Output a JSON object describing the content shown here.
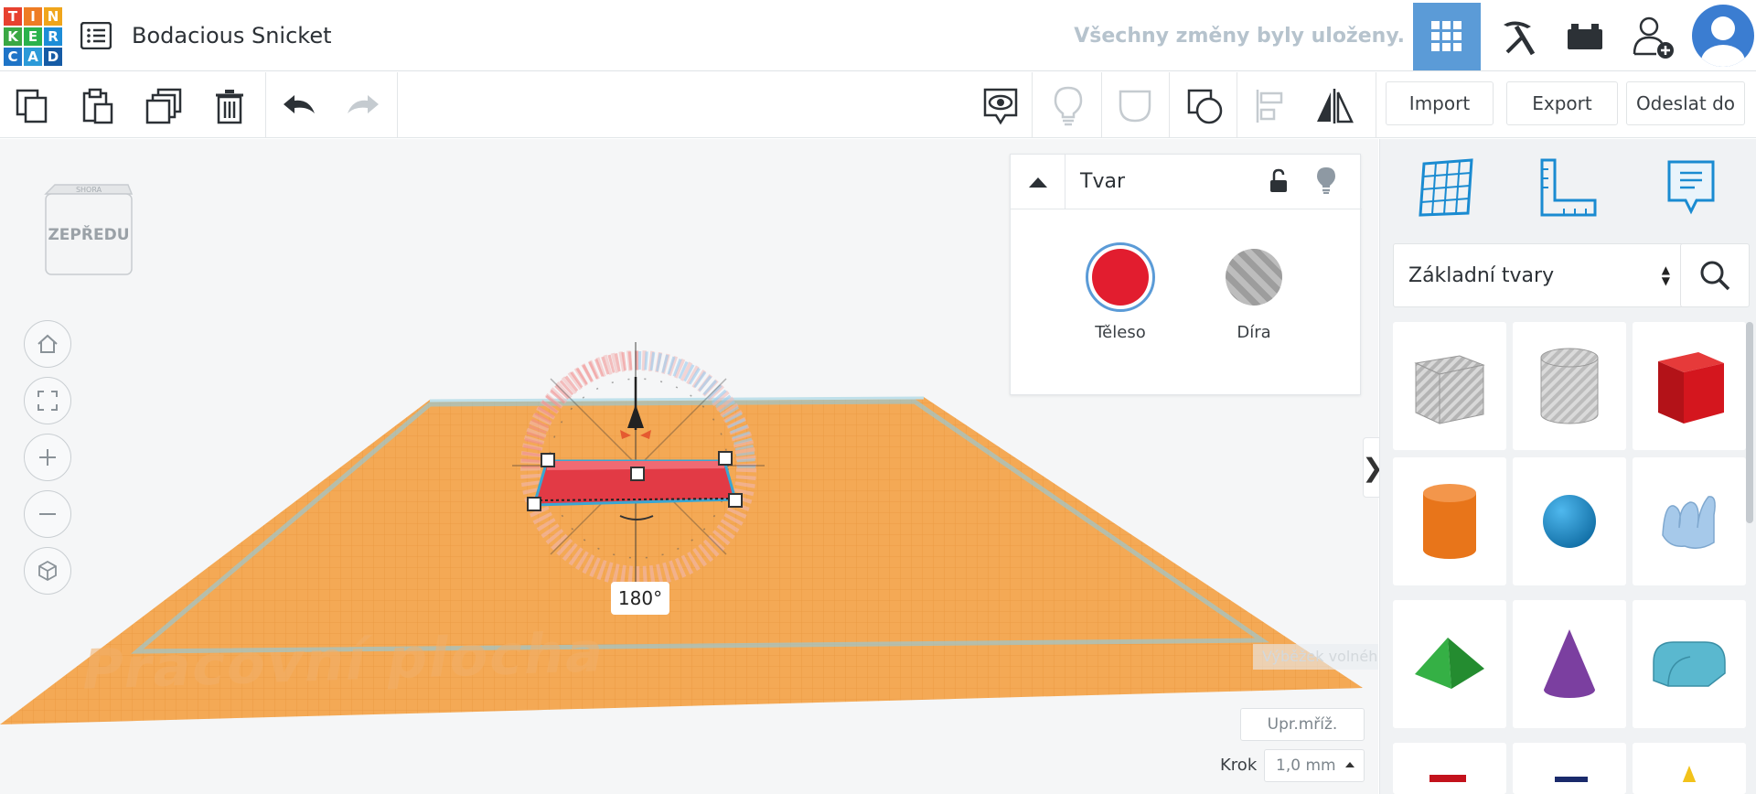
{
  "app": {
    "logo_letters": [
      "T",
      "I",
      "N",
      "K",
      "E",
      "R",
      "C",
      "A",
      "D"
    ],
    "design_title": "Bodacious Snicket",
    "save_status": "Všechny změny byly uloženy."
  },
  "toolbar": {
    "import_label": "Import",
    "export_label": "Export",
    "send_label": "Odeslat do"
  },
  "viewcube": {
    "face_label": "ZEPŘEDU",
    "top_label": "SHORA"
  },
  "workplane": {
    "label": "Pracovní plocha",
    "rotation_readout": "180°",
    "ghost_tooltip": "Výběžek volného tvaru"
  },
  "grid_controls": {
    "edit_grid_label": "Upr.mříž.",
    "step_label": "Krok",
    "step_value": "1,0 mm"
  },
  "inspector": {
    "title": "Tvar",
    "solid_label": "Těleso",
    "hole_label": "Díra",
    "solid_color": "#e21d2f"
  },
  "shapes_panel": {
    "category": "Základní tvary",
    "tiles": [
      {
        "name": "box-hole",
        "color": "#bdbdbd"
      },
      {
        "name": "cylinder-hole",
        "color": "#c8c8c8"
      },
      {
        "name": "box",
        "color": "#d4161e"
      },
      {
        "name": "cylinder",
        "color": "#e8751a"
      },
      {
        "name": "sphere",
        "color": "#1b8dcc"
      },
      {
        "name": "scribble",
        "color": "#a6c9ea"
      },
      {
        "name": "pyramid",
        "color": "#2e9e3a"
      },
      {
        "name": "cone",
        "color": "#7b3fa0"
      },
      {
        "name": "roof",
        "color": "#5ab8cf"
      }
    ]
  },
  "colors": {
    "accent": "#5b9bd7",
    "workplane_orange": "#f0a04b"
  }
}
